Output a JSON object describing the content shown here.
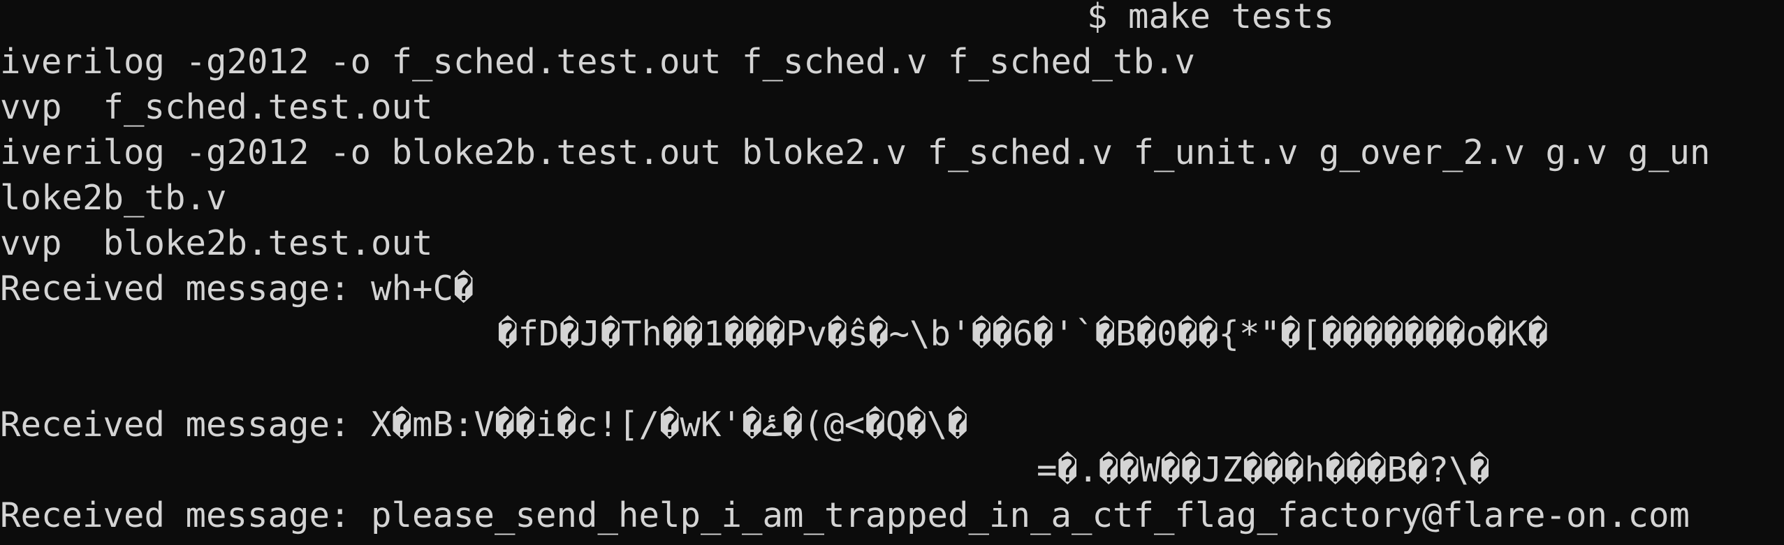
{
  "terminal": {
    "lines": [
      "$ make tests",
      "iverilog -g2012 -o f_sched.test.out f_sched.v f_sched_tb.v",
      "vvp  f_sched.test.out",
      "iverilog -g2012 -o bloke2b.test.out bloke2.v f_sched.v f_unit.v g_over_2.v g.v g_un",
      "loke2b_tb.v",
      "vvp  bloke2b.test.out",
      "Received message: wh+C�",
      "�fD�J�Th��1���Pv�ŝ�~\\b'��6�'`�B�0��{*\"�[�������o�K�",
      "",
      "Received message: X�mB:V��i�c![/�wK'�ۓ�(@<�Q�\\�",
      "=�.��W��JZ���h���B�?\\�",
      "Received message: please_send_help_i_am_trapped_in_a_ctf_flag_factory@flare-on.com"
    ]
  },
  "colors": {
    "background": "#0c0c0c",
    "foreground": "#d4d4d4"
  }
}
